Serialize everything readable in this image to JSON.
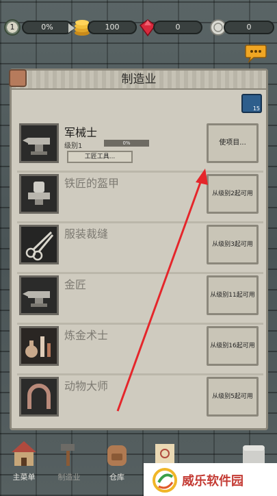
{
  "topbar": {
    "level": "1",
    "progress": "0%",
    "gold": "100",
    "gems": "0",
    "tokens": "0"
  },
  "panel": {
    "title": "制造业",
    "map_badge": "15"
  },
  "professions": [
    {
      "name": "军械士",
      "level_label": "级别1",
      "progress": "0%",
      "tools_label": "工匠工具...",
      "action": "使项目...",
      "icon": "anvil-icon"
    },
    {
      "name": "铁匠的盔甲",
      "action": "从级别2起可用",
      "icon": "armor-anvil-icon"
    },
    {
      "name": "服装裁缝",
      "action": "从级别3起可用",
      "icon": "scissors-icon"
    },
    {
      "name": "金匠",
      "action": "从级别11起可用",
      "icon": "gold-anvil-icon"
    },
    {
      "name": "炼金术士",
      "action": "从级别16起可用",
      "icon": "potion-icon"
    },
    {
      "name": "动物大师",
      "action": "从级别5起可用",
      "icon": "horseshoe-icon"
    }
  ],
  "nav": {
    "home": "主菜单",
    "craft": "制造业",
    "storage": "仓库"
  },
  "watermark": {
    "text": "威乐软件园"
  },
  "colors": {
    "accent_arrow": "#e5262b",
    "progress_fill": "#9ad07a",
    "panel_bg": "#cfcbbf"
  }
}
